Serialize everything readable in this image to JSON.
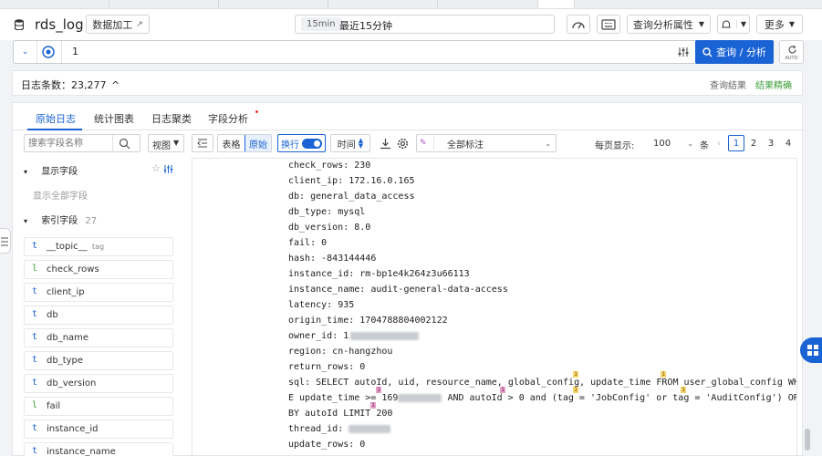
{
  "header": {
    "logstore_name": "rds_log",
    "data_process_label": "数据加工",
    "time_tag": "15min",
    "time_range": "最近15分钟",
    "query_attr_label": "查询分析属性",
    "more_label": "更多"
  },
  "query": {
    "text": "1",
    "submit_label": "查询 / 分析",
    "auto_label": "AUTO"
  },
  "count": {
    "label": "日志条数：23,277",
    "arrow": "^",
    "result_label": "查询结果",
    "precise_label": "结果精确"
  },
  "tabs": [
    "原始日志",
    "统计图表",
    "日志聚类",
    "字段分析"
  ],
  "sidebar": {
    "search_placeholder": "搜索字段名称",
    "view_label": "视图",
    "shown_fields_label": "显示字段",
    "show_all_label": "显示全部字段",
    "index_fields_label": "索引字段",
    "index_fields_count": "27",
    "fields": [
      {
        "type": "t",
        "name": "__topic__",
        "tag": "tag"
      },
      {
        "type": "l",
        "name": "check_rows",
        "tag": ""
      },
      {
        "type": "t",
        "name": "client_ip",
        "tag": ""
      },
      {
        "type": "t",
        "name": "db",
        "tag": ""
      },
      {
        "type": "t",
        "name": "db_name",
        "tag": ""
      },
      {
        "type": "t",
        "name": "db_type",
        "tag": ""
      },
      {
        "type": "t",
        "name": "db_version",
        "tag": ""
      },
      {
        "type": "l",
        "name": "fail",
        "tag": ""
      },
      {
        "type": "t",
        "name": "instance_id",
        "tag": ""
      },
      {
        "type": "t",
        "name": "instance_name",
        "tag": ""
      }
    ]
  },
  "toolbar": {
    "table_label": "表格",
    "raw_label": "原始",
    "wrap_label": "换行",
    "time_label": "时间",
    "tag_select": "全部标注",
    "per_page_label": "每页显示:",
    "per_page_value": "100",
    "per_page_unit": "条",
    "pages": [
      "1",
      "2",
      "3",
      "4"
    ]
  },
  "log": {
    "lines": [
      {
        "key": "check_rows",
        "value": "230"
      },
      {
        "key": "client_ip",
        "value": "172.16.0.165"
      },
      {
        "key": "db",
        "value": "general_data_access"
      },
      {
        "key": "db_type",
        "value": "mysql"
      },
      {
        "key": "db_version",
        "value": "8.0"
      },
      {
        "key": "fail",
        "value": "0"
      },
      {
        "key": "hash",
        "value": "-843144446"
      },
      {
        "key": "instance_id",
        "value": "rm-bp1e4k264z3u66113"
      },
      {
        "key": "instance_name",
        "value": "audit-general-data-access"
      },
      {
        "key": "latency",
        "value": "935"
      },
      {
        "key": "origin_time",
        "value": "1704788804002122"
      },
      {
        "key": "owner_id",
        "value": "1"
      },
      {
        "key": "region",
        "value": "cn-hangzhou"
      },
      {
        "key": "return_rows",
        "value": "0"
      }
    ],
    "sql_key": "sql",
    "sql_line1": "SELECT autoId, uid, resource_name, global_config, update_time FROM user_global_config WHER",
    "sql_line2a": "E update_time >= 169",
    "sql_line2b": " AND autoId > 0 and (tag = 'JobConfig' or tag = 'AuditConfig') ORDER",
    "sql_line3": "BY autoId LIMIT 200",
    "thread_key": "thread_id",
    "update_key": "update_rows",
    "update_value": "0",
    "mark_label": "1"
  }
}
